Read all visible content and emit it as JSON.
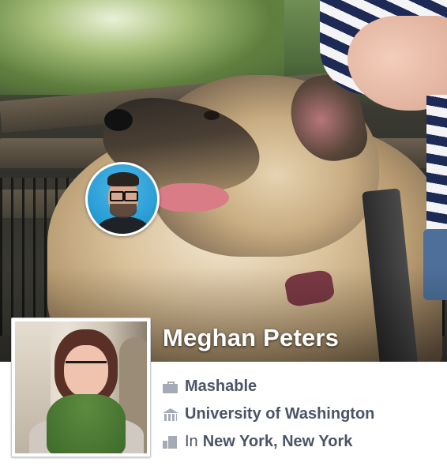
{
  "profile": {
    "name": "Meghan Peters"
  },
  "info": {
    "work": {
      "icon": "briefcase-icon",
      "label": "Mashable"
    },
    "education": {
      "icon": "school-icon",
      "label": "University of Washington"
    },
    "location": {
      "icon": "city-icon",
      "prefix": "In",
      "label": "New York, New York"
    }
  },
  "colors": {
    "info_text": "#4b5466",
    "icon_gray": "#a5abb6",
    "name_text": "#ffffff"
  }
}
